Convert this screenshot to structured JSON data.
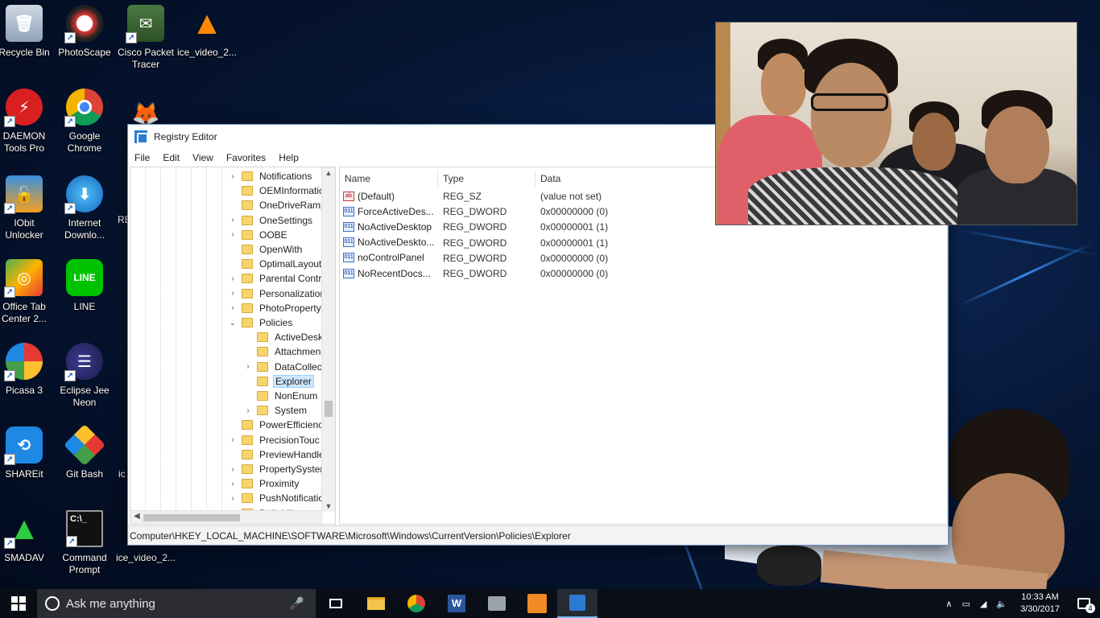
{
  "desktop": {
    "icons": [
      {
        "id": "recycle-bin",
        "label": "Recycle Bin"
      },
      {
        "id": "photoscape",
        "label": "PhotoScape"
      },
      {
        "id": "cisco",
        "label": "Cisco Packet Tracer"
      },
      {
        "id": "vlc",
        "label": "ice_video_2..."
      },
      {
        "id": "daemon",
        "label": "DAEMON Tools Pro"
      },
      {
        "id": "chrome",
        "label": "Google Chrome"
      },
      {
        "id": "iobit",
        "label": "IObit Unlocker"
      },
      {
        "id": "idm",
        "label": "Internet Downlo..."
      },
      {
        "id": "officetab",
        "label": "Office Tab Center 2..."
      },
      {
        "id": "line",
        "label": "LINE"
      },
      {
        "id": "picasa",
        "label": "Picasa 3"
      },
      {
        "id": "eclipse",
        "label": "Eclipse Jee Neon"
      },
      {
        "id": "shareit",
        "label": "SHAREit"
      },
      {
        "id": "gitbash",
        "label": "Git Bash"
      },
      {
        "id": "smadav",
        "label": "SMADAV"
      },
      {
        "id": "cmd",
        "label": "Command Prompt"
      },
      {
        "id": "icevideo2",
        "label": "ice_video_2..."
      }
    ],
    "partial_labels": {
      "re": "RE",
      "ic": "ic"
    }
  },
  "registry": {
    "title": "Registry Editor",
    "menu": [
      "File",
      "Edit",
      "View",
      "Favorites",
      "Help"
    ],
    "tree": [
      {
        "label": "Notifications",
        "exp": ">"
      },
      {
        "label": "OEMInformatio",
        "exp": ""
      },
      {
        "label": "OneDriveRamp",
        "exp": ""
      },
      {
        "label": "OneSettings",
        "exp": ">"
      },
      {
        "label": "OOBE",
        "exp": ">"
      },
      {
        "label": "OpenWith",
        "exp": ""
      },
      {
        "label": "OptimalLayout",
        "exp": ""
      },
      {
        "label": "Parental Contr",
        "exp": ">"
      },
      {
        "label": "Personalization",
        "exp": ">"
      },
      {
        "label": "PhotoProperty",
        "exp": ">"
      },
      {
        "label": "Policies",
        "exp": "v"
      },
      {
        "label": "ActiveDesk",
        "exp": ""
      },
      {
        "label": "Attachmen",
        "exp": ""
      },
      {
        "label": "DataCollec",
        "exp": ">"
      },
      {
        "label": "Explorer",
        "exp": ""
      },
      {
        "label": "NonEnum",
        "exp": ""
      },
      {
        "label": "System",
        "exp": ">"
      },
      {
        "label": "PowerEfficienc",
        "exp": ""
      },
      {
        "label": "PrecisionTouc",
        "exp": ">"
      },
      {
        "label": "PreviewHandle",
        "exp": ""
      },
      {
        "label": "PropertySyster",
        "exp": ">"
      },
      {
        "label": "Proximity",
        "exp": ">"
      },
      {
        "label": "PushNotificatic",
        "exp": ">"
      },
      {
        "label": "Reliability",
        "exp": ">"
      }
    ],
    "columns": {
      "name": "Name",
      "type": "Type",
      "data": "Data"
    },
    "values": [
      {
        "name": "(Default)",
        "type": "REG_SZ",
        "data": "(value not set)",
        "kind": "sz"
      },
      {
        "name": "ForceActiveDes...",
        "type": "REG_DWORD",
        "data": "0x00000000 (0)",
        "kind": "dword"
      },
      {
        "name": "NoActiveDesktop",
        "type": "REG_DWORD",
        "data": "0x00000001 (1)",
        "kind": "dword"
      },
      {
        "name": "NoActiveDeskto...",
        "type": "REG_DWORD",
        "data": "0x00000001 (1)",
        "kind": "dword"
      },
      {
        "name": "noControlPanel",
        "type": "REG_DWORD",
        "data": "0x00000000 (0)",
        "kind": "dword"
      },
      {
        "name": "NoRecentDocs...",
        "type": "REG_DWORD",
        "data": "0x00000000 (0)",
        "kind": "dword"
      }
    ],
    "status_path": "Computer\\HKEY_LOCAL_MACHINE\\SOFTWARE\\Microsoft\\Windows\\CurrentVersion\\Policies\\Explorer"
  },
  "taskbar": {
    "search_placeholder": "Ask me anything",
    "time": "10:33 AM",
    "date": "3/30/2017",
    "notification_count": "4"
  }
}
